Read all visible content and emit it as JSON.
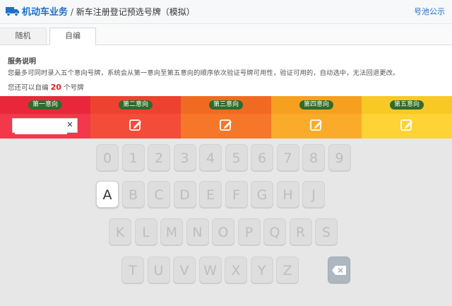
{
  "header": {
    "section": "机动车业务",
    "separator": "/",
    "page_title": "新车注册登记预选号牌（模拟）",
    "public_link": "号池公示"
  },
  "tabs": [
    {
      "label": "随机",
      "active": false
    },
    {
      "label": "自编",
      "active": true
    }
  ],
  "service": {
    "title": "服务说明",
    "description": "您最多可同时录入五个意向号牌，系统会从第一意向至第五意向的顺序依次验证号牌可用性，验证可用的，自动选中，无法回退更改。",
    "remaining_prefix": "您还可以自编",
    "remaining_count": "20",
    "remaining_suffix": "个号牌"
  },
  "intents": [
    {
      "label": "第一意向",
      "color_header": "#e8283a",
      "color_body": "#f2384a",
      "mode": "input",
      "value": ""
    },
    {
      "label": "第二意向",
      "color_header": "#ed4230",
      "color_body": "#f34d3a",
      "mode": "edit"
    },
    {
      "label": "第三意向",
      "color_header": "#f06a22",
      "color_body": "#f6772a",
      "mode": "edit"
    },
    {
      "label": "第四意向",
      "color_header": "#f6a020",
      "color_body": "#fbab2a",
      "mode": "edit"
    },
    {
      "label": "第五意向",
      "color_header": "#f8c825",
      "color_body": "#fdd335",
      "mode": "edit"
    }
  ],
  "keyboard": {
    "rows": [
      [
        "0",
        "1",
        "2",
        "3",
        "4",
        "5",
        "6",
        "7",
        "8",
        "9"
      ],
      [
        "A",
        "B",
        "C",
        "D",
        "E",
        "F",
        "G",
        "H",
        "J"
      ],
      [
        "K",
        "L",
        "M",
        "N",
        "O",
        "P",
        "Q",
        "R",
        "S"
      ],
      [
        "T",
        "U",
        "V",
        "W",
        "X",
        "Y",
        "Z"
      ]
    ],
    "active_key": "A",
    "delete_key": "delete"
  },
  "colors": {
    "link_blue": "#1f6fc5",
    "count_red": "#e02020",
    "label_green": "#2f6b2a"
  },
  "icons": [
    "truck-icon",
    "edit-icon",
    "clear-icon",
    "backspace-icon"
  ]
}
